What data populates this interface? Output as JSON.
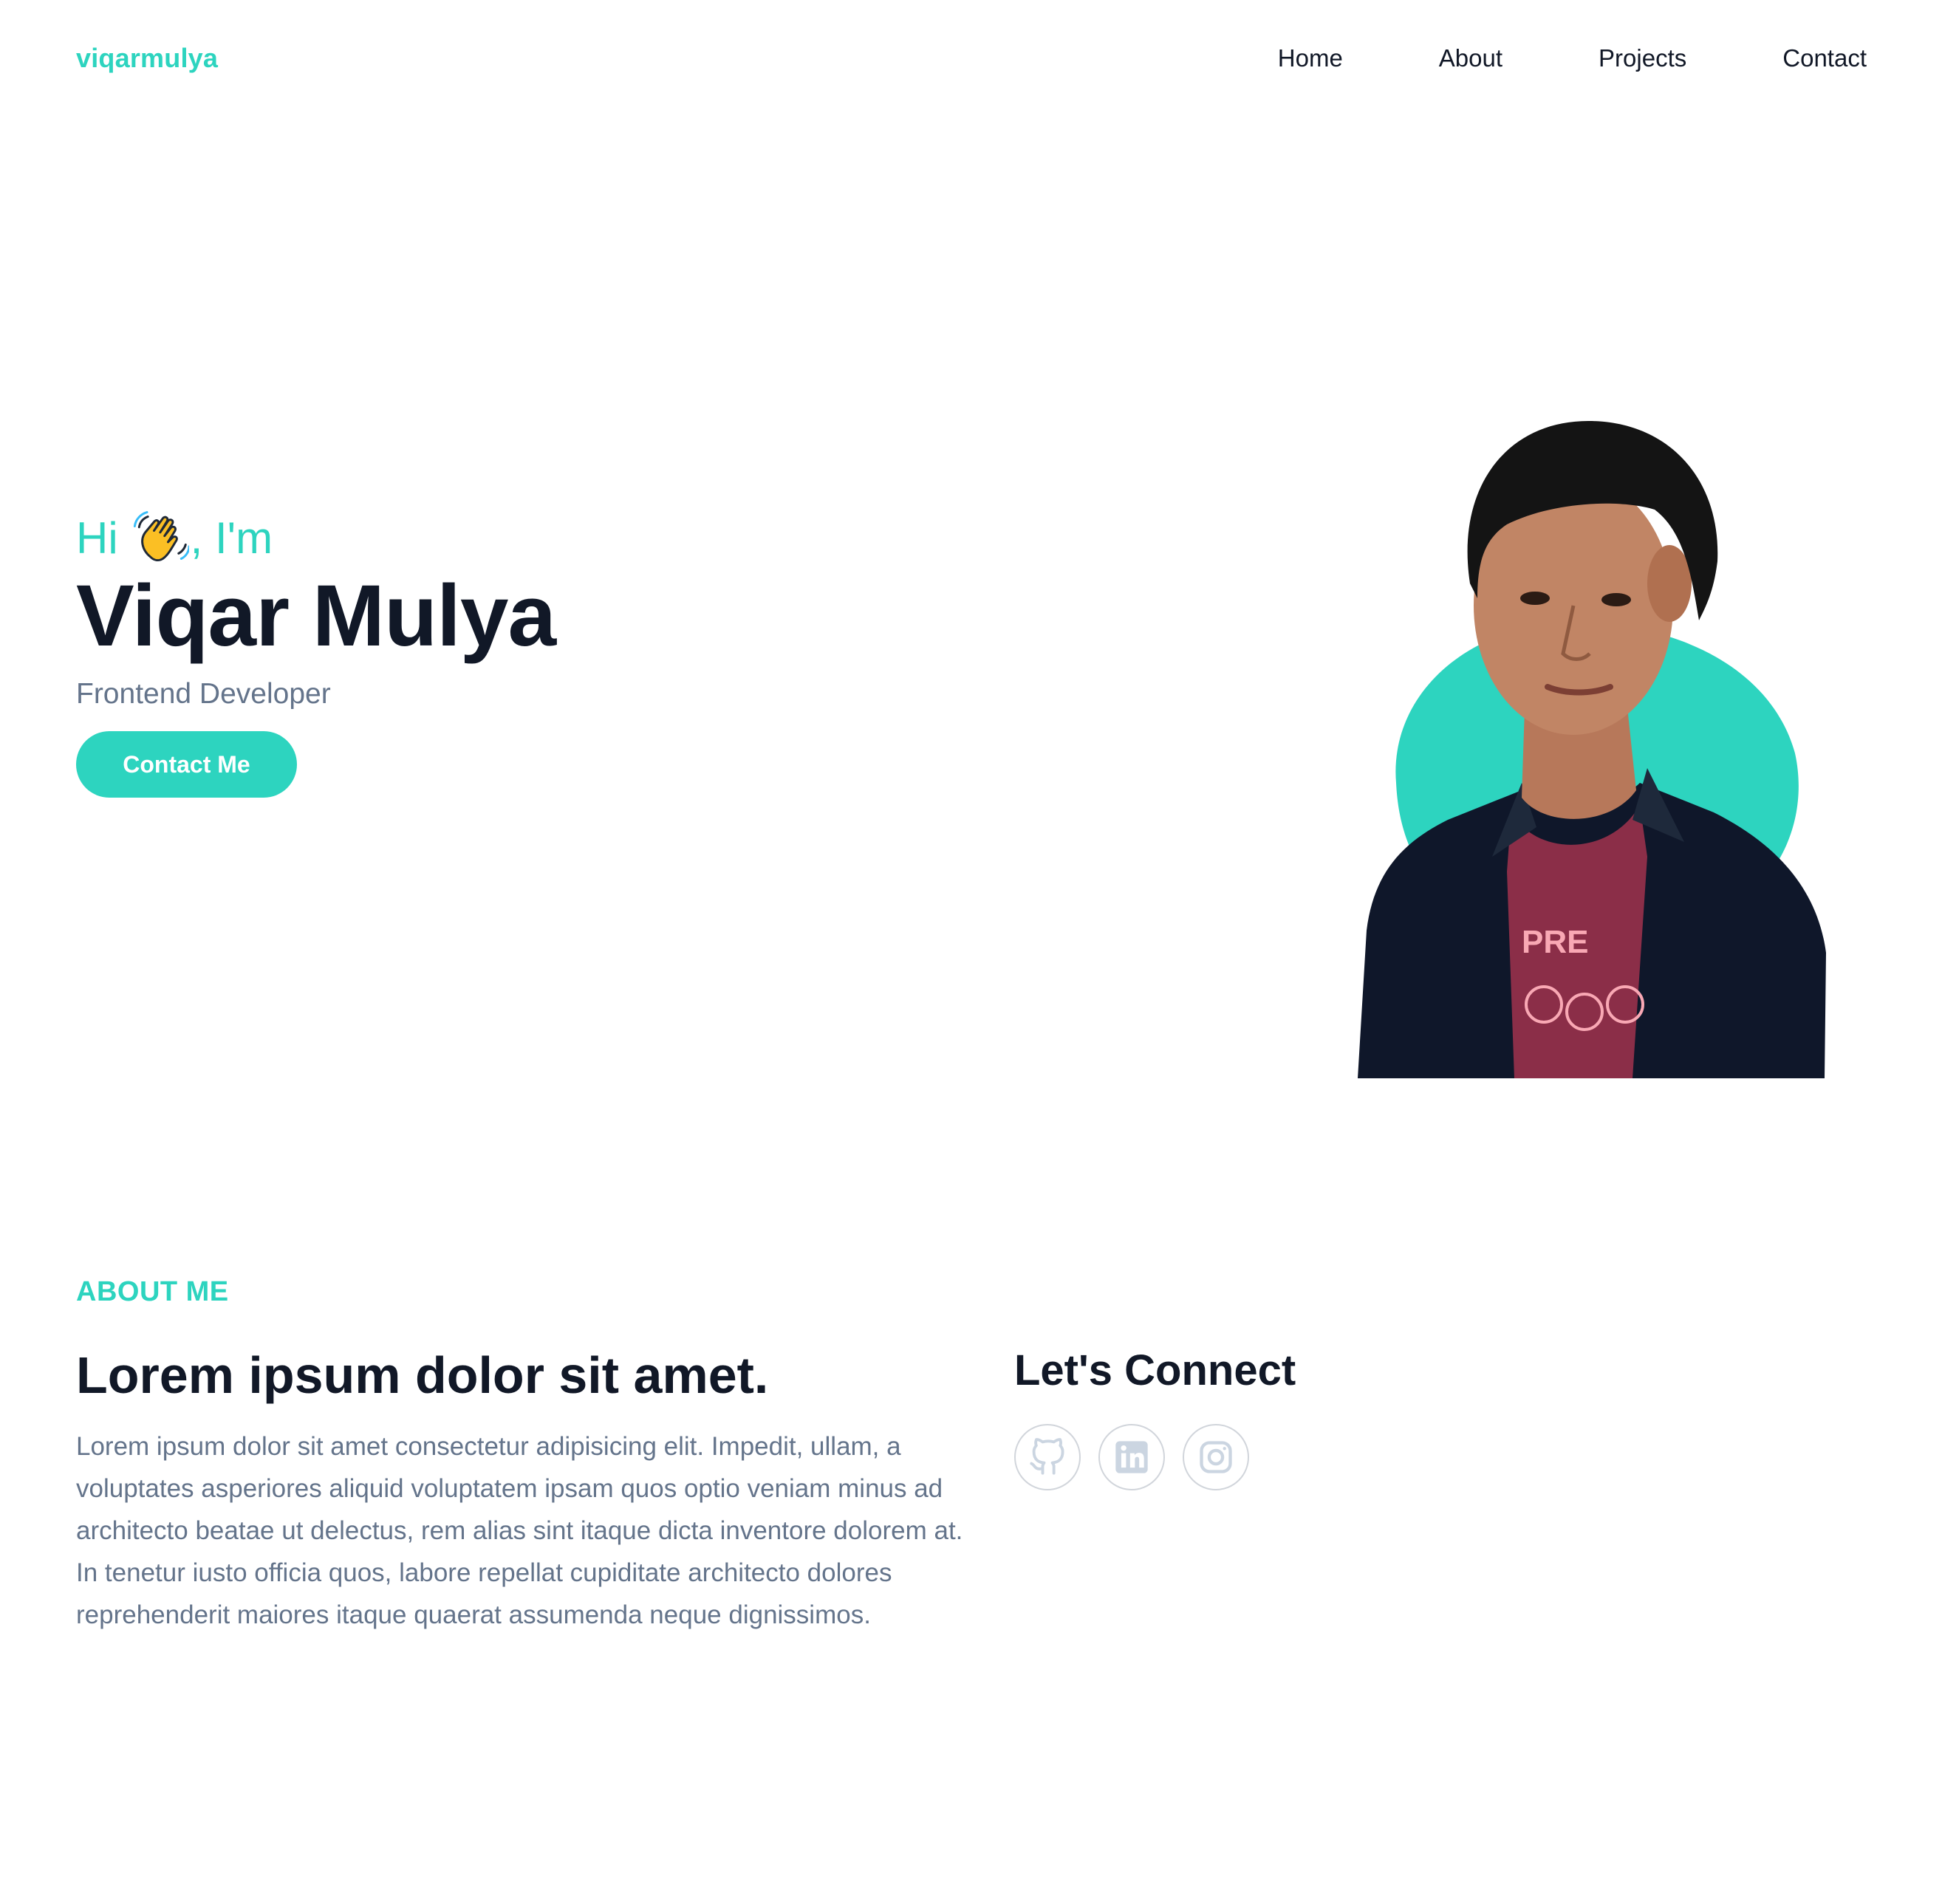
{
  "nav": {
    "brand": "viqarmulya",
    "links": [
      "Home",
      "About",
      "Projects",
      "Contact"
    ]
  },
  "hero": {
    "greeting_prefix": "Hi",
    "greeting_suffix": ", I'm",
    "greeting_icon": "waving-hand-icon",
    "name": "Viqar Mulya",
    "role": "Frontend Developer",
    "cta_label": "Contact Me"
  },
  "about": {
    "label": "ABOUT ME",
    "heading": "Lorem ipsum dolor sit amet.",
    "text": "Lorem ipsum dolor sit amet consectetur adipisicing elit. Impedit, ullam, a voluptates asperiores aliquid voluptatem ipsam quos optio veniam minus ad architecto beatae ut delectus, rem alias sint itaque dicta inventore dolorem at. In tenetur iusto officia quos, labore repellat cupiditate architecto dolores reprehenderit maiores itaque quaerat assumenda neque dignissimos.",
    "connect_heading": "Let's Connect",
    "socials": [
      "github-icon",
      "linkedin-icon",
      "instagram-icon"
    ]
  },
  "colors": {
    "accent": "#2dd4bf",
    "heading": "#111827",
    "muted": "#64748b",
    "icon_gray": "#cbd5e1"
  }
}
